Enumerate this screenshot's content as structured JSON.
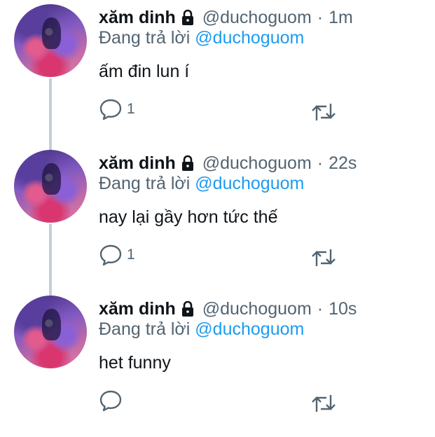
{
  "tweets": [
    {
      "name": "xăm dinh",
      "handle": "@duchoguom",
      "time": "1m",
      "reply_prefix": "Đang trả lời",
      "reply_to": "@duchoguom",
      "text": "ấm đin lun í",
      "reply_count": "1"
    },
    {
      "name": "xăm dinh",
      "handle": "@duchoguom",
      "time": "22s",
      "reply_prefix": "Đang trả lời",
      "reply_to": "@duchoguom",
      "text": "nay lại gầy hơn tức thế",
      "reply_count": "1"
    },
    {
      "name": "xăm dinh",
      "handle": "@duchoguom",
      "time": "10s",
      "reply_prefix": "Đang trả lời",
      "reply_to": "@duchoguom",
      "text": "het funny",
      "reply_count": ""
    }
  ],
  "separator": "·",
  "icons": {
    "lock": "lock-icon",
    "reply": "reply-icon",
    "retweet": "retweet-icon"
  },
  "colors": {
    "link": "#1d9bf0",
    "muted": "#536471",
    "thread_line": "#c4cfd6"
  }
}
